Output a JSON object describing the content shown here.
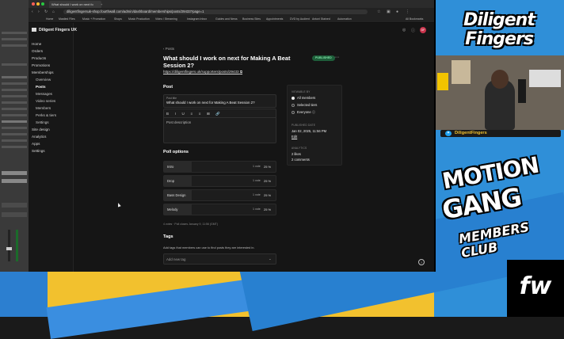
{
  "browser": {
    "tabs": [
      {
        "label": "What should I work on next fo"
      }
    ],
    "url": "diligentfingersuk-shop.fourthwall.com/admin/dashboard/memberships/posts/29433?page=1",
    "bookmarks": [
      "Home",
      "Mastled Files",
      "Music + Promotion",
      "Shops",
      "Music Production",
      "Video / Streaming",
      "Instagram Inbox",
      "Guides and News",
      "Business Sites",
      "Appointments",
      "DVD by Audient",
      "Antoni Stained",
      "Automation",
      "All Bookmarks"
    ]
  },
  "app": {
    "brand": "Diligent Fingers UK",
    "avatar_initials": "DF",
    "nav": [
      {
        "label": "Home",
        "level": 0
      },
      {
        "label": "Orders",
        "level": 0
      },
      {
        "label": "Products",
        "level": 0
      },
      {
        "label": "Promotions",
        "level": 0
      },
      {
        "label": "Memberships",
        "level": 0
      },
      {
        "label": "Overview",
        "level": 1
      },
      {
        "label": "Posts",
        "level": 1
      },
      {
        "label": "Messages",
        "level": 1
      },
      {
        "label": "Video series",
        "level": 1
      },
      {
        "label": "Members",
        "level": 1
      },
      {
        "label": "Perks & tiers",
        "level": 1
      },
      {
        "label": "Settings",
        "level": 1
      },
      {
        "label": "Site design",
        "level": 0
      },
      {
        "label": "Analytics",
        "level": 0
      },
      {
        "label": "Apps",
        "level": 0
      },
      {
        "label": "Settings",
        "level": 0
      }
    ],
    "breadcrumb": "Posts",
    "post_title": "What should I work on next for Making A Beat Session 2?",
    "post_link": "https://diligentfingers.uk/supporters/posts/29433",
    "status_badge": "PUBLISHED",
    "post_section": "Post",
    "title_label": "Post title",
    "title_value": "What should I work on next for Making A Beat Session 2?",
    "editor_toolbar": "B I U ≡ ≡ ⊞ 🔗",
    "description_placeholder": "Post description",
    "poll_section": "Poll options",
    "poll_options": [
      {
        "label": "Intro",
        "votes": "1 vote",
        "pct": "25 %",
        "fraction": 0.25
      },
      {
        "label": "Drop",
        "votes": "1 vote",
        "pct": "25 %",
        "fraction": 0.25
      },
      {
        "label": "Bass Design",
        "votes": "1 vote",
        "pct": "25 %",
        "fraction": 0.25
      },
      {
        "label": "Melody",
        "votes": "1 vote",
        "pct": "25 %",
        "fraction": 0.25
      }
    ],
    "poll_meta": "4 votes · Poll closes January 9, 11:56 (GMT)",
    "tags_section": "Tags",
    "tags_help": "Add tags that members can use to find posts they are interested in.",
    "tags_placeholder": "Add new tag",
    "panel": {
      "viewable_label": "VIEWABLE BY",
      "options": [
        {
          "label": "All members",
          "selected": true
        },
        {
          "label": "Selected tiers",
          "selected": false
        },
        {
          "label": "Everyone ⓘ",
          "selected": false
        }
      ],
      "published_label": "PUBLISHED DATE",
      "published_value": "Jan 02, 2025, 11:56 PM",
      "edit_label": "Edit",
      "analytics_label": "ANALYTICS",
      "likes": "2 likes",
      "comments": "2 comments"
    },
    "help": "?"
  },
  "overlay": {
    "logo": "Diligent Fingers",
    "handle": "DiligentFingers",
    "club_line1": "MOTION",
    "club_line2": "GANG",
    "club_line3": "MEMBERS CLUB",
    "fw": "fw"
  }
}
